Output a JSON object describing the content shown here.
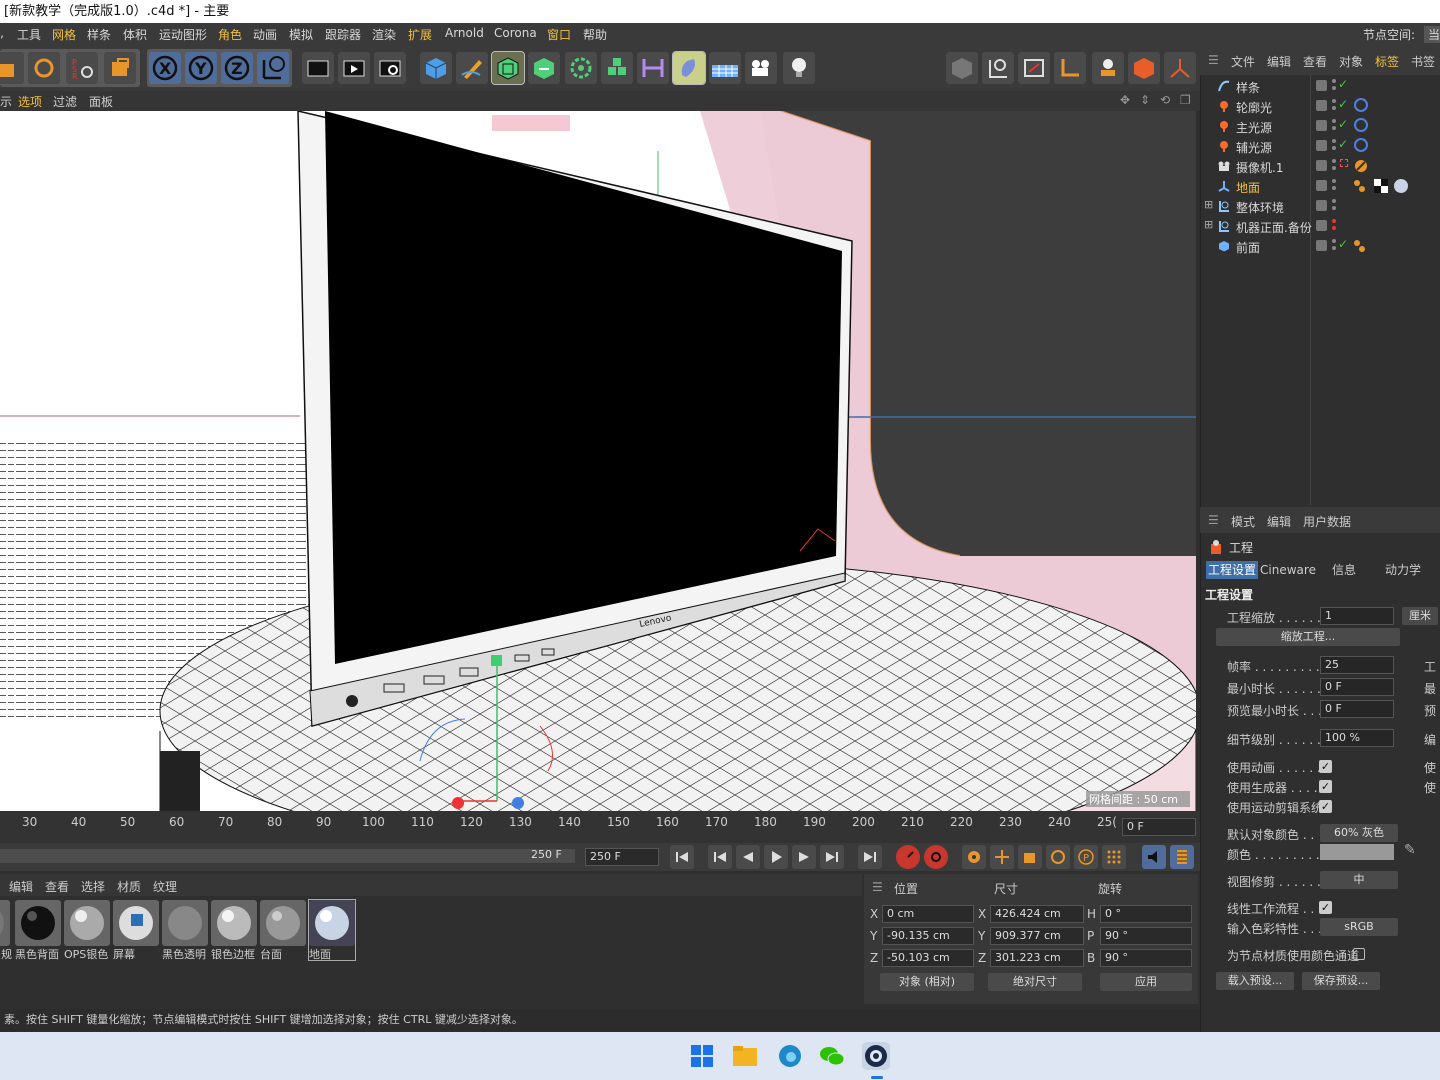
{
  "window": {
    "title": "[新款教学（完成版1.0）.c4d *] - 主要"
  },
  "menu": {
    "items": [
      {
        "label": "工具"
      },
      {
        "label": "网格",
        "hl": true
      },
      {
        "label": "样条"
      },
      {
        "label": "体积"
      },
      {
        "label": "运动图形"
      },
      {
        "label": "角色",
        "hl": true
      },
      {
        "label": "动画"
      },
      {
        "label": "模拟"
      },
      {
        "label": "跟踪器"
      },
      {
        "label": "渲染"
      },
      {
        "label": "扩展",
        "hl": true
      },
      {
        "label": "Arnold"
      },
      {
        "label": "Corona"
      },
      {
        "label": "窗口",
        "hl": true
      },
      {
        "label": "帮助"
      }
    ],
    "node_space_label": "节点空间:",
    "node_space_value": "当"
  },
  "viewport_menu": {
    "items": [
      "示",
      "选项",
      "过滤",
      "面板"
    ]
  },
  "viewport": {
    "grid_spacing": "网格间距 : 50 cm",
    "monitor_brand": "Lenovo"
  },
  "timeline": {
    "ticks": [
      "30",
      "40",
      "50",
      "60",
      "70",
      "80",
      "90",
      "100",
      "110",
      "120",
      "130",
      "140",
      "150",
      "160",
      "170",
      "180",
      "190",
      "200",
      "210",
      "220",
      "230",
      "240",
      "25("
    ],
    "current_frame": "0 F",
    "end_frame_display": "250 F",
    "end_frame_field": "250 F"
  },
  "materials": {
    "menu": [
      "编辑",
      "查看",
      "选择",
      "材质",
      "纹理"
    ],
    "items": [
      {
        "label": "规",
        "color": "#777777"
      },
      {
        "label": "黑色背面",
        "color": "#111111"
      },
      {
        "label": "OPS银色",
        "color": "#aaaaaa"
      },
      {
        "label": "屏幕",
        "color": "#dddddd"
      },
      {
        "label": "黑色透明",
        "color": "#888888"
      },
      {
        "label": "银色边框",
        "color": "#bbbbbb"
      },
      {
        "label": "台面",
        "color": "#999999"
      },
      {
        "label": "地面",
        "color": "#c8d4e6",
        "selected": true
      }
    ]
  },
  "coords": {
    "headers": {
      "pos": "位置",
      "size": "尺寸",
      "rot": "旋转"
    },
    "rows": [
      {
        "axis": "X",
        "pos": "0 cm",
        "saxis": "X",
        "size": "426.424 cm",
        "raxis": "H",
        "rot": "0 °"
      },
      {
        "axis": "Y",
        "pos": "-90.135 cm",
        "saxis": "Y",
        "size": "909.377 cm",
        "raxis": "P",
        "rot": "90 °"
      },
      {
        "axis": "Z",
        "pos": "-50.103 cm",
        "saxis": "Z",
        "size": "301.223 cm",
        "raxis": "B",
        "rot": "90 °"
      }
    ],
    "mode": "对象 (相对)",
    "size_mode": "绝对尺寸",
    "apply": "应用"
  },
  "status": "素。按住 SHIFT 键量化缩放；节点编辑模式时按住 SHIFT 键增加选择对象；按住 CTRL 键减少选择对象。",
  "objects": {
    "menu": [
      "文件",
      "编辑",
      "查看",
      "对象",
      "标签",
      "书签"
    ],
    "items": [
      {
        "name": "样条",
        "icon": "spline-icon",
        "color": "#8ec6ff",
        "check": true,
        "tag": false
      },
      {
        "name": "轮廓光",
        "icon": "light-icon",
        "color": "#ff6a2a",
        "check": true,
        "tag": true
      },
      {
        "name": "主光源",
        "icon": "light-icon",
        "color": "#ff6a2a",
        "check": true,
        "tag": true
      },
      {
        "name": "辅光源",
        "icon": "light-icon",
        "color": "#ff6a2a",
        "check": true,
        "tag": true
      },
      {
        "name": "摄像机.1",
        "icon": "camera-icon",
        "color": "#dddddd",
        "check": false,
        "tag": false
      },
      {
        "name": "地面",
        "icon": "floor-icon",
        "color": "#6fb0ff",
        "check": false,
        "tag": false,
        "hl": true
      },
      {
        "name": "整体环境",
        "icon": "null-icon",
        "color": "#8ec6ff",
        "check": false,
        "tag": false
      },
      {
        "name": "机器正面.备份",
        "icon": "null-icon",
        "color": "#8ec6ff",
        "check": false,
        "tag": false
      },
      {
        "name": "前面",
        "icon": "cube-icon",
        "color": "#6fb0ff",
        "check": true,
        "tag": false
      }
    ]
  },
  "attributes": {
    "menu": [
      "模式",
      "编辑",
      "用户数据"
    ],
    "object_title": "工程",
    "tabs": [
      {
        "label": "工程设置",
        "on": true
      },
      {
        "label": "Cineware"
      },
      {
        "label": "信息"
      },
      {
        "label": "动力学"
      }
    ],
    "section": "工程设置",
    "scale_label": "工程缩放 . . . . . .",
    "scale_value": "1",
    "scale_unit": "厘米",
    "scale_button": "缩放工程...",
    "fps_label": "帧率 . . . . . . . . .",
    "fps_value": "25",
    "min_label": "最小时长 . . . . . .",
    "min_value": "0 F",
    "preview_min_label": "预览最小时长 . . .",
    "preview_min_value": "0 F",
    "lod_label": "细节级别 . . . . . .",
    "lod_value": "100 %",
    "use_anim": "使用动画 . . . . . .",
    "use_gen": "使用生成器 . . . . .",
    "use_motion": "使用运动剪辑系统",
    "default_color_label": "默认对象颜色 . .",
    "default_color_value": "60% 灰色",
    "color_label": "颜色 . . . . . . . . .",
    "view_clip_label": "视图修剪 . . . . . .",
    "view_clip_value": "中",
    "linear_label": "线性工作流程 . . .",
    "input_color_label": "输入色彩特性 . . .",
    "input_color_value": "sRGB",
    "node_color_label": "为节点材质使用颜色通道",
    "load_preset": "载入预设...",
    "save_preset": "保存预设...",
    "right_clip": [
      "工",
      "最",
      "预",
      "编",
      "使",
      "使"
    ]
  }
}
